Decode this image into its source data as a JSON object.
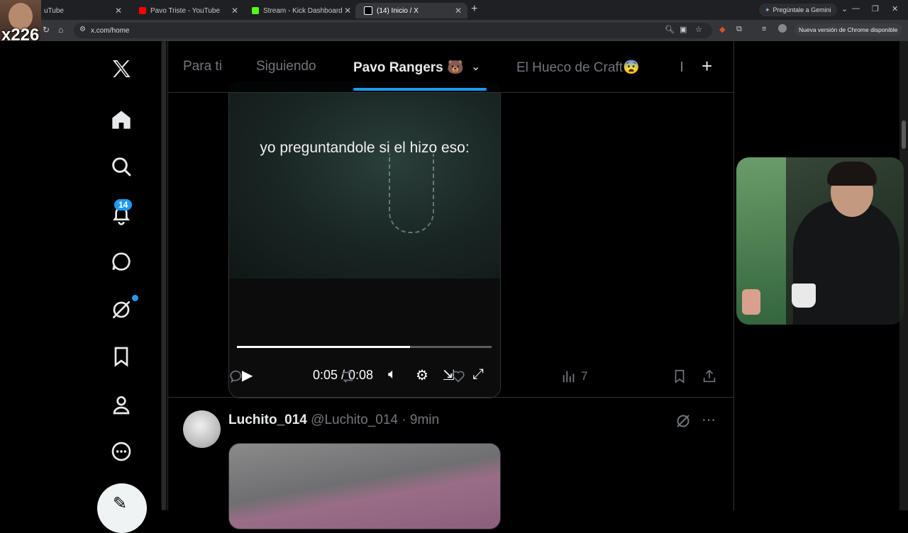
{
  "browser": {
    "tabs": [
      {
        "title": "uTube",
        "favicon_color": "#ff0000",
        "active": false
      },
      {
        "title": "Pavo Triste - YouTube",
        "favicon_color": "#ff0000",
        "active": false
      },
      {
        "title": "Stream - Kick Dashboard",
        "favicon_color": "#53fc18",
        "active": false
      },
      {
        "title": "(14) Inicio / X",
        "favicon_color": "#ffffff",
        "active": true
      }
    ],
    "new_tab": "+",
    "gemini_label": "Pregúntale a Gemini",
    "url": "x.com/home",
    "update_label": "Nueva versión de Chrome disponible"
  },
  "stream_overlay": {
    "label": "x226"
  },
  "sidebar": {
    "items": [
      {
        "name": "x-logo-icon"
      },
      {
        "name": "home-icon"
      },
      {
        "name": "search-icon"
      },
      {
        "name": "notifications-icon"
      },
      {
        "name": "messages-icon"
      },
      {
        "name": "grok-icon"
      },
      {
        "name": "bookmarks-icon"
      },
      {
        "name": "profile-icon"
      },
      {
        "name": "more-icon"
      }
    ],
    "notification_count": "14"
  },
  "timeline": {
    "tabs": [
      {
        "label": "Para ti"
      },
      {
        "label": "Siguiendo"
      },
      {
        "label": "Pavo Rangers 🐻"
      },
      {
        "label": "El Hueco de Craft😨"
      }
    ],
    "active_tab": "Pavo Rangers 🐻"
  },
  "video": {
    "caption": "yo preguntandole si el hizo eso:",
    "time": "0:05 / 0:08",
    "progress": 0.68
  },
  "tweet_actions": {
    "views": "7"
  },
  "next_tweet": {
    "display_name": "Luchito_014",
    "handle": "@Luchito_014",
    "time": "· 9min"
  }
}
